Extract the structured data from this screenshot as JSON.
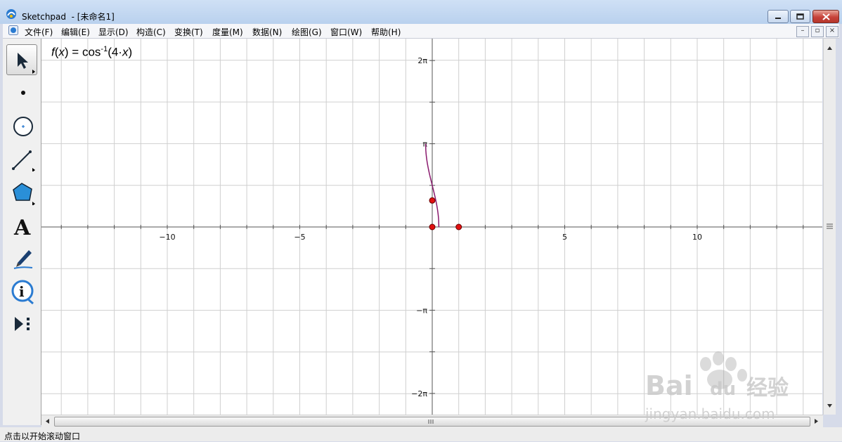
{
  "window": {
    "title": "Sketchpad  - [未命名1]"
  },
  "menu": [
    "文件(F)",
    "编辑(E)",
    "显示(D)",
    "构造(C)",
    "变换(T)",
    "度量(M)",
    "数据(N)",
    "绘图(G)",
    "窗口(W)",
    "帮助(H)"
  ],
  "toolbox": [
    "arrow-tool",
    "point-tool",
    "compass-tool",
    "straightedge-tool",
    "polygon-tool",
    "text-tool",
    "marker-tool",
    "information-tool",
    "custom-tool"
  ],
  "function_label": {
    "f": "f",
    "x1": "x",
    "eq": ") = cos",
    "sup": "-1",
    "arg": "(4·",
    "x2": "x",
    "close": ")"
  },
  "graph": {
    "x_ticks": [
      "−10",
      "−5",
      "5",
      "10"
    ],
    "y_ticks": [
      "2π",
      "π",
      "−π",
      "−2π"
    ]
  },
  "status": {
    "text": "点击以开始滚动窗口"
  },
  "watermark": {
    "brand": "Bai",
    "brand_icon": "du",
    "brand_cn": "经验",
    "url": "jingyan.baidu.com"
  },
  "colors": {
    "curve": "#8a1a6e",
    "point": "#e01010",
    "grid": "#cfcfcf"
  }
}
